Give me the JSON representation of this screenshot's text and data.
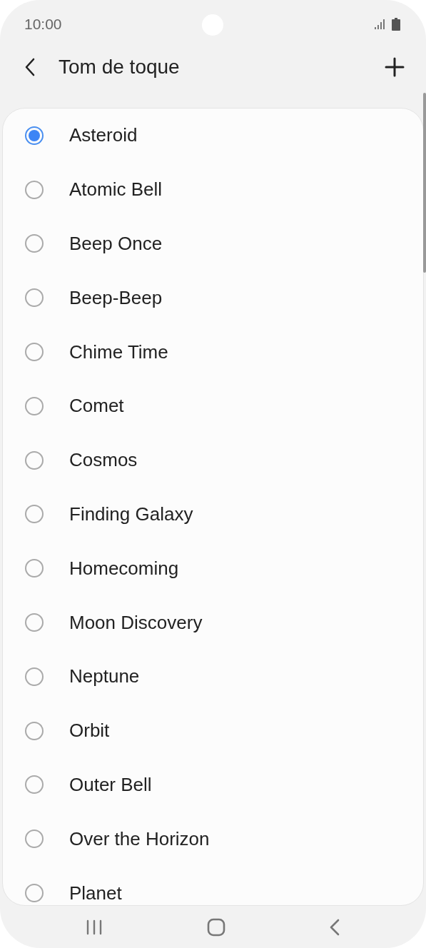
{
  "status_bar": {
    "time": "10:00"
  },
  "header": {
    "title": "Tom de toque"
  },
  "ringtones": [
    {
      "label": "Asteroid",
      "selected": true
    },
    {
      "label": "Atomic Bell",
      "selected": false
    },
    {
      "label": "Beep Once",
      "selected": false
    },
    {
      "label": "Beep-Beep",
      "selected": false
    },
    {
      "label": "Chime Time",
      "selected": false
    },
    {
      "label": "Comet",
      "selected": false
    },
    {
      "label": "Cosmos",
      "selected": false
    },
    {
      "label": "Finding Galaxy",
      "selected": false
    },
    {
      "label": "Homecoming",
      "selected": false
    },
    {
      "label": "Moon Discovery",
      "selected": false
    },
    {
      "label": "Neptune",
      "selected": false
    },
    {
      "label": "Orbit",
      "selected": false
    },
    {
      "label": "Outer Bell",
      "selected": false
    },
    {
      "label": "Over the Horizon",
      "selected": false
    },
    {
      "label": "Planet",
      "selected": false
    }
  ]
}
